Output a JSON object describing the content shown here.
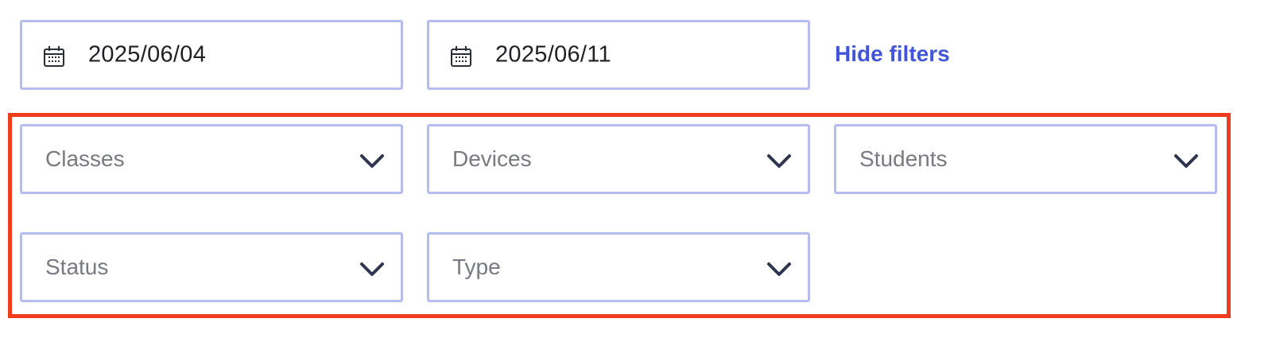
{
  "date_range": {
    "start": {
      "value": "2025/06/04",
      "icon": "calendar-icon"
    },
    "end": {
      "value": "2025/06/11",
      "icon": "calendar-icon"
    }
  },
  "hide_filters_label": "Hide filters",
  "filters": {
    "classes": {
      "placeholder": "Classes",
      "icon": "chevron-down-icon"
    },
    "devices": {
      "placeholder": "Devices",
      "icon": "chevron-down-icon"
    },
    "students": {
      "placeholder": "Students",
      "icon": "chevron-down-icon"
    },
    "status": {
      "placeholder": "Status",
      "icon": "chevron-down-icon"
    },
    "type": {
      "placeholder": "Type",
      "icon": "chevron-down-icon"
    }
  },
  "colors": {
    "field_border": "#b6bdee",
    "link": "#4255d8",
    "highlight_border": "#f03c1e",
    "chevron": "#2f3650",
    "placeholder_text": "#777a80"
  }
}
